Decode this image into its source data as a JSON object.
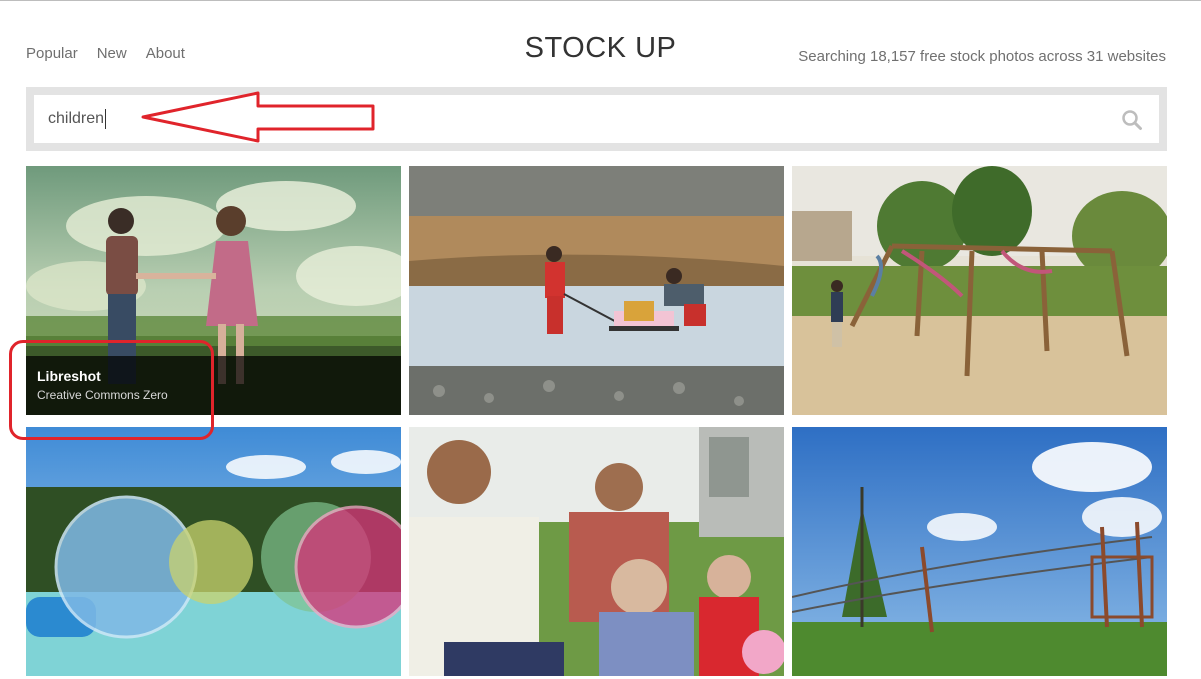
{
  "header": {
    "nav": [
      "Popular",
      "New",
      "About"
    ],
    "brand": "STOCK UP",
    "tagline": "Searching 18,157 free stock photos across 31 websites"
  },
  "search": {
    "value": "children",
    "icon": "search-icon"
  },
  "results": [
    {
      "source": "Libreshot",
      "license": "Creative Commons Zero",
      "hovered": true
    },
    {
      "hovered": false
    },
    {
      "hovered": false
    },
    {
      "hovered": false
    },
    {
      "hovered": false
    },
    {
      "hovered": false
    }
  ],
  "annotations": {
    "arrow_color": "#e0242b",
    "highlight_color": "#e0242b"
  }
}
